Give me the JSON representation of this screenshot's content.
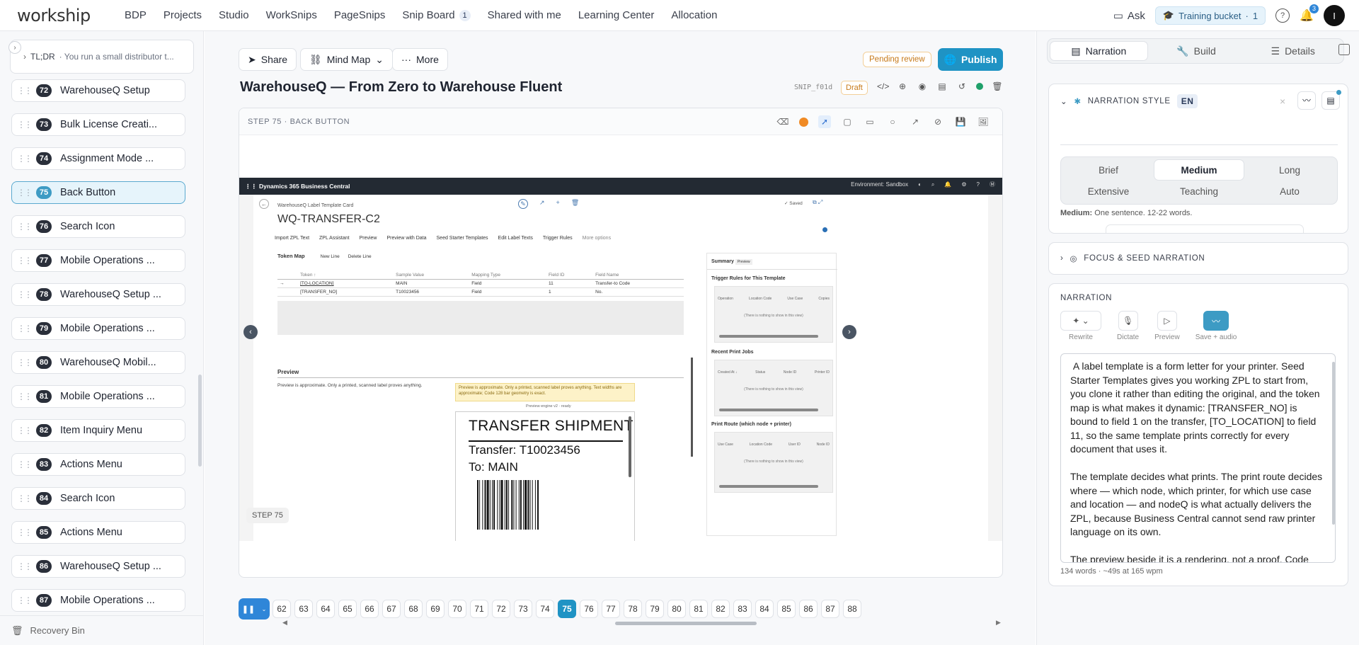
{
  "app": {
    "logo": "workship"
  },
  "nav": {
    "items": [
      "BDP",
      "Projects",
      "Studio",
      "WorkSnips",
      "PageSnips",
      "Snip Board",
      "Shared with me",
      "Learning Center",
      "Allocation"
    ],
    "snip_board_count": "1"
  },
  "top_right": {
    "ask": "Ask",
    "bucket": "Training bucket",
    "bucket_count": "1",
    "notif_count": "3",
    "avatar": "I"
  },
  "sidebar": {
    "tldr_label": "TL;DR",
    "tldr_text": "· You run a small distributor t...",
    "steps": [
      {
        "num": "72",
        "label": "WarehouseQ Setup"
      },
      {
        "num": "73",
        "label": "Bulk License Creati..."
      },
      {
        "num": "74",
        "label": "Assignment Mode ..."
      },
      {
        "num": "75",
        "label": "Back Button",
        "active": true
      },
      {
        "num": "76",
        "label": "Search Icon"
      },
      {
        "num": "77",
        "label": "Mobile Operations ..."
      },
      {
        "num": "78",
        "label": "WarehouseQ Setup ..."
      },
      {
        "num": "79",
        "label": "Mobile Operations ..."
      },
      {
        "num": "80",
        "label": "WarehouseQ Mobil..."
      },
      {
        "num": "81",
        "label": "Mobile Operations ..."
      },
      {
        "num": "82",
        "label": "Item Inquiry Menu"
      },
      {
        "num": "83",
        "label": "Actions Menu"
      },
      {
        "num": "84",
        "label": "Search Icon"
      },
      {
        "num": "85",
        "label": "Actions Menu"
      },
      {
        "num": "86",
        "label": "WarehouseQ Setup ..."
      },
      {
        "num": "87",
        "label": "Mobile Operations ..."
      }
    ],
    "recovery_bin": "Recovery Bin"
  },
  "toolbar": {
    "share": "Share",
    "mind_map": "Mind Map",
    "more": "More",
    "pending": "Pending review",
    "publish": "Publish"
  },
  "doc": {
    "title": "WarehouseQ — From Zero to Warehouse Fluent",
    "snip_id": "SNIP_f01d",
    "status": "Draft"
  },
  "canvas": {
    "header": "STEP 75 · BACK BUTTON",
    "step_tag": "STEP 75"
  },
  "shot": {
    "app_title": "Dynamics 365 Business Central",
    "env": "Environment: Sandbox",
    "breadcrumb": "WarehouseQ Label Template Card",
    "record": "WQ-TRANSFER-C2",
    "saved": "✓ Saved",
    "actions": [
      "Import ZPL Text",
      "ZPL Assistant",
      "Preview",
      "Preview with Data",
      "Seed Starter Templates",
      "Edit Label Texts",
      "Trigger Rules",
      "More options"
    ],
    "token_map": "Token Map",
    "new_line": "New Line",
    "delete_line": "Delete Line",
    "columns": [
      "Token ↑",
      "Sample Value",
      "Mapping Type",
      "Field ID",
      "Field Name"
    ],
    "rows": [
      [
        "[TO-LOCATION]",
        "MAIN",
        "Field",
        "11",
        "Transfer-to Code"
      ],
      [
        "[TRANSFER_NO]",
        "T10023456",
        "Field",
        "1",
        "No."
      ]
    ],
    "preview_h": "Preview",
    "preview_t": "Preview is approximate. Only a printed, scanned label proves anything.",
    "warn": "Preview is approximate. Only a printed, scanned label proves anything. Text widths are approximate; Code 128 bar geometry is exact.",
    "engine": "Preview engine v2 · ready",
    "label_title": "TRANSFER SHIPMENT",
    "label_l2": "Transfer: T10023456",
    "label_l3": "To: MAIN",
    "summary": "Summary",
    "summary_tag": "Preview",
    "trigger_rules": "Trigger Rules for This Template",
    "tr_cols": [
      "Operation",
      "Location Code",
      "Use Case",
      "Copies"
    ],
    "empty": "(There is nothing to show in this view)",
    "recent_jobs": "Recent Print Jobs",
    "rj_cols": [
      "Created At ↓",
      "Status",
      "Node ID",
      "Printer ID"
    ],
    "print_route": "Print Route (which node + printer)",
    "pr_cols": [
      "Use Case",
      "Location Code",
      "User ID",
      "Node ID"
    ]
  },
  "strip": {
    "steps": [
      "62",
      "63",
      "64",
      "65",
      "66",
      "67",
      "68",
      "69",
      "70",
      "71",
      "72",
      "73",
      "74",
      "75",
      "76",
      "77",
      "78",
      "79",
      "80",
      "81",
      "82",
      "83",
      "84",
      "85",
      "86",
      "87",
      "88"
    ],
    "active": "75"
  },
  "right": {
    "tabs": [
      "Narration",
      "Build",
      "Details"
    ],
    "style_title": "NARRATION STYLE",
    "lang": "EN",
    "lengths": [
      "Brief",
      "Medium",
      "Long",
      "Extensive",
      "Teaching",
      "Auto"
    ],
    "selected_length": "Medium",
    "length_desc_key": "Medium:",
    "length_desc": "One sentence. 12-22 words.",
    "focus_title": "FOCUS & SEED NARRATION",
    "narration_title": "NARRATION",
    "narr_tools": [
      "Rewrite",
      "Dictate",
      "Preview",
      "Save + audio"
    ],
    "narration_text": " A label template is a form letter for your printer. Seed Starter Templates gives you working ZPL to start from, you clone it rather than editing the original, and the token map is what makes it dynamic: [TRANSFER_NO] is bound to field 1 on the transfer, [TO_LOCATION] to field 11, so the same template prints correctly for every document that uses it.\n\nThe template decides what prints. The print route decides where — which node, which printer, for which use case and location — and nodeQ is what actually delivers the ZPL, because Business Central cannot send raw printer language on its own.\n\nThe preview beside it is a rendering, not a proof. Code",
    "word_count": "134 words · ~49s at 165 wpm"
  }
}
